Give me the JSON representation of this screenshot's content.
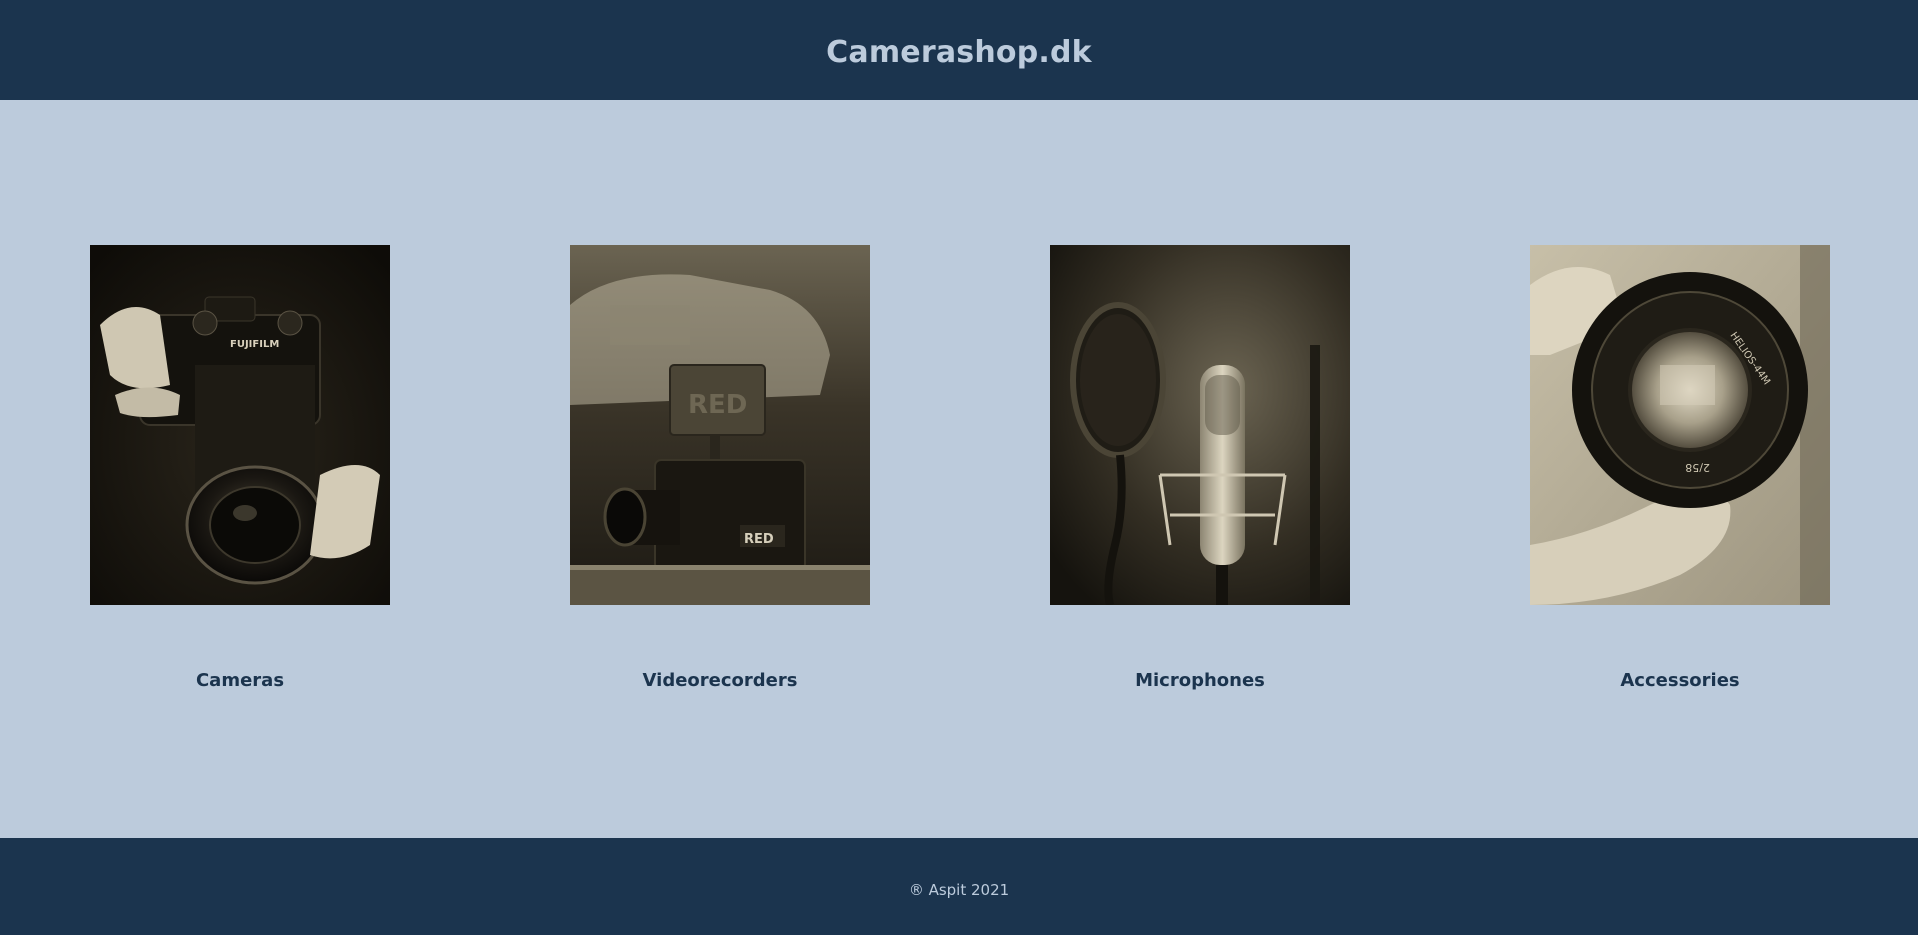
{
  "header": {
    "site_title": "Camerashop.dk"
  },
  "categories": [
    {
      "label": "Cameras",
      "image_icon": "camera-photo"
    },
    {
      "label": "Videorecorders",
      "image_icon": "cinema-camera-photo"
    },
    {
      "label": "Microphones",
      "image_icon": "microphone-photo"
    },
    {
      "label": "Accessories",
      "image_icon": "lens-photo"
    }
  ],
  "footer": {
    "copyright": "® Aspit 2021"
  },
  "colors": {
    "header_bg": "#1b344e",
    "page_bg": "#bccbdc",
    "label_text": "#1b344e",
    "header_text": "#bccbdc"
  }
}
